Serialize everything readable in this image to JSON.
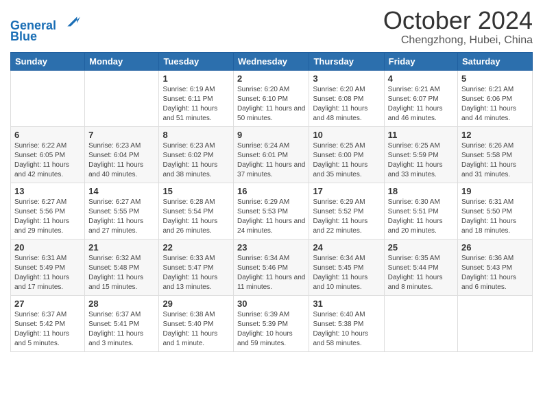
{
  "header": {
    "logo_line1": "General",
    "logo_line2": "Blue",
    "month": "October 2024",
    "location": "Chengzhong, Hubei, China"
  },
  "weekdays": [
    "Sunday",
    "Monday",
    "Tuesday",
    "Wednesday",
    "Thursday",
    "Friday",
    "Saturday"
  ],
  "weeks": [
    [
      {
        "day": "",
        "info": ""
      },
      {
        "day": "",
        "info": ""
      },
      {
        "day": "1",
        "info": "Sunrise: 6:19 AM\nSunset: 6:11 PM\nDaylight: 11 hours and 51 minutes."
      },
      {
        "day": "2",
        "info": "Sunrise: 6:20 AM\nSunset: 6:10 PM\nDaylight: 11 hours and 50 minutes."
      },
      {
        "day": "3",
        "info": "Sunrise: 6:20 AM\nSunset: 6:08 PM\nDaylight: 11 hours and 48 minutes."
      },
      {
        "day": "4",
        "info": "Sunrise: 6:21 AM\nSunset: 6:07 PM\nDaylight: 11 hours and 46 minutes."
      },
      {
        "day": "5",
        "info": "Sunrise: 6:21 AM\nSunset: 6:06 PM\nDaylight: 11 hours and 44 minutes."
      }
    ],
    [
      {
        "day": "6",
        "info": "Sunrise: 6:22 AM\nSunset: 6:05 PM\nDaylight: 11 hours and 42 minutes."
      },
      {
        "day": "7",
        "info": "Sunrise: 6:23 AM\nSunset: 6:04 PM\nDaylight: 11 hours and 40 minutes."
      },
      {
        "day": "8",
        "info": "Sunrise: 6:23 AM\nSunset: 6:02 PM\nDaylight: 11 hours and 38 minutes."
      },
      {
        "day": "9",
        "info": "Sunrise: 6:24 AM\nSunset: 6:01 PM\nDaylight: 11 hours and 37 minutes."
      },
      {
        "day": "10",
        "info": "Sunrise: 6:25 AM\nSunset: 6:00 PM\nDaylight: 11 hours and 35 minutes."
      },
      {
        "day": "11",
        "info": "Sunrise: 6:25 AM\nSunset: 5:59 PM\nDaylight: 11 hours and 33 minutes."
      },
      {
        "day": "12",
        "info": "Sunrise: 6:26 AM\nSunset: 5:58 PM\nDaylight: 11 hours and 31 minutes."
      }
    ],
    [
      {
        "day": "13",
        "info": "Sunrise: 6:27 AM\nSunset: 5:56 PM\nDaylight: 11 hours and 29 minutes."
      },
      {
        "day": "14",
        "info": "Sunrise: 6:27 AM\nSunset: 5:55 PM\nDaylight: 11 hours and 27 minutes."
      },
      {
        "day": "15",
        "info": "Sunrise: 6:28 AM\nSunset: 5:54 PM\nDaylight: 11 hours and 26 minutes."
      },
      {
        "day": "16",
        "info": "Sunrise: 6:29 AM\nSunset: 5:53 PM\nDaylight: 11 hours and 24 minutes."
      },
      {
        "day": "17",
        "info": "Sunrise: 6:29 AM\nSunset: 5:52 PM\nDaylight: 11 hours and 22 minutes."
      },
      {
        "day": "18",
        "info": "Sunrise: 6:30 AM\nSunset: 5:51 PM\nDaylight: 11 hours and 20 minutes."
      },
      {
        "day": "19",
        "info": "Sunrise: 6:31 AM\nSunset: 5:50 PM\nDaylight: 11 hours and 18 minutes."
      }
    ],
    [
      {
        "day": "20",
        "info": "Sunrise: 6:31 AM\nSunset: 5:49 PM\nDaylight: 11 hours and 17 minutes."
      },
      {
        "day": "21",
        "info": "Sunrise: 6:32 AM\nSunset: 5:48 PM\nDaylight: 11 hours and 15 minutes."
      },
      {
        "day": "22",
        "info": "Sunrise: 6:33 AM\nSunset: 5:47 PM\nDaylight: 11 hours and 13 minutes."
      },
      {
        "day": "23",
        "info": "Sunrise: 6:34 AM\nSunset: 5:46 PM\nDaylight: 11 hours and 11 minutes."
      },
      {
        "day": "24",
        "info": "Sunrise: 6:34 AM\nSunset: 5:45 PM\nDaylight: 11 hours and 10 minutes."
      },
      {
        "day": "25",
        "info": "Sunrise: 6:35 AM\nSunset: 5:44 PM\nDaylight: 11 hours and 8 minutes."
      },
      {
        "day": "26",
        "info": "Sunrise: 6:36 AM\nSunset: 5:43 PM\nDaylight: 11 hours and 6 minutes."
      }
    ],
    [
      {
        "day": "27",
        "info": "Sunrise: 6:37 AM\nSunset: 5:42 PM\nDaylight: 11 hours and 5 minutes."
      },
      {
        "day": "28",
        "info": "Sunrise: 6:37 AM\nSunset: 5:41 PM\nDaylight: 11 hours and 3 minutes."
      },
      {
        "day": "29",
        "info": "Sunrise: 6:38 AM\nSunset: 5:40 PM\nDaylight: 11 hours and 1 minute."
      },
      {
        "day": "30",
        "info": "Sunrise: 6:39 AM\nSunset: 5:39 PM\nDaylight: 10 hours and 59 minutes."
      },
      {
        "day": "31",
        "info": "Sunrise: 6:40 AM\nSunset: 5:38 PM\nDaylight: 10 hours and 58 minutes."
      },
      {
        "day": "",
        "info": ""
      },
      {
        "day": "",
        "info": ""
      }
    ]
  ]
}
